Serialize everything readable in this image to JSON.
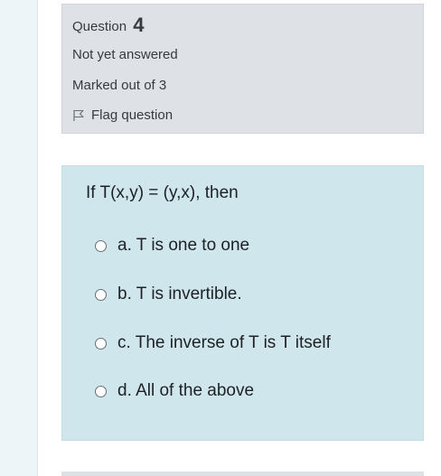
{
  "info": {
    "question_label": "Question",
    "question_number": "4",
    "state": "Not yet answered",
    "grade": "Marked out of 3",
    "flag_label": "Flag question",
    "flag_icon": "flag-outline-icon"
  },
  "question": {
    "text": "If T(x,y) = (y,x), then",
    "answers": [
      {
        "label": "a. T is one to one"
      },
      {
        "label": "b. T is invertible."
      },
      {
        "label": "c. The inverse of T is T itself"
      },
      {
        "label": "d. All of the above"
      }
    ]
  },
  "colors": {
    "info_bg": "#dee2e6",
    "content_bg": "#cfe6ec",
    "left_strip": "#eef5f9"
  }
}
